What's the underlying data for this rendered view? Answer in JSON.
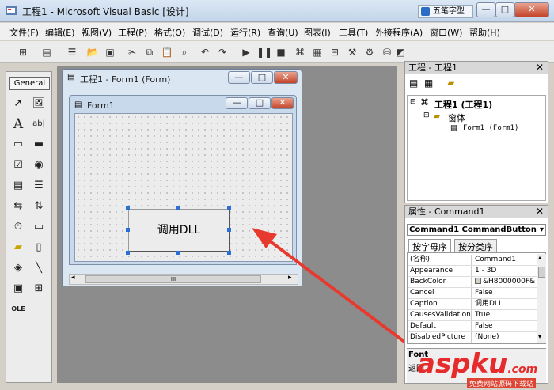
{
  "window": {
    "title": "工程1 - Microsoft Visual Basic [设计]",
    "ime_label": "五笔字型",
    "minimize": "—",
    "maximize": "□",
    "close": "✕"
  },
  "menu": [
    "文件(F)",
    "编辑(E)",
    "视图(V)",
    "工程(P)",
    "格式(O)",
    "调试(D)",
    "运行(R)",
    "查询(U)",
    "图表(I)",
    "工具(T)",
    "外接程序(A)",
    "窗口(W)",
    "帮助(H)"
  ],
  "toolbox": {
    "tab": "General",
    "tools": [
      "pointer-icon",
      "picturebox-icon",
      "label-icon",
      "textbox-icon",
      "frame-icon",
      "commandbutton-icon",
      "checkbox-icon",
      "optionbutton-icon",
      "combobox-icon",
      "listbox-icon",
      "hscrollbar-icon",
      "vscrollbar-icon",
      "timer-icon",
      "drivelistbox-icon",
      "dirlistbox-icon",
      "filelistbox-icon",
      "shape-icon",
      "line-icon",
      "image-icon",
      "data-icon",
      "ole-icon"
    ]
  },
  "project_form_window": {
    "title": "工程1 - Form1 (Form)"
  },
  "form": {
    "title": "Form1",
    "button_caption": "调用DLL",
    "scroll_grip": "III"
  },
  "project_explorer": {
    "title": "工程 - 工程1",
    "root": "工程1 (工程1)",
    "folder": "窗体",
    "item": "Form1 (Form1)"
  },
  "properties": {
    "title": "属性 - Command1",
    "object": "Command1 CommandButton",
    "tab_alpha": "按字母序",
    "tab_category": "按分类序",
    "rows": [
      {
        "name": "(名称)",
        "value": "Command1"
      },
      {
        "name": "Appearance",
        "value": "1 - 3D"
      },
      {
        "name": "BackColor",
        "value": "&H8000000F&"
      },
      {
        "name": "Cancel",
        "value": "False"
      },
      {
        "name": "Caption",
        "value": "调用DLL"
      },
      {
        "name": "CausesValidation",
        "value": "True"
      },
      {
        "name": "Default",
        "value": "False"
      },
      {
        "name": "DisabledPicture",
        "value": "(None)"
      }
    ],
    "desc_title": "Font",
    "desc_text": "返回"
  },
  "watermark": {
    "brand": "aspku",
    "suffix": ".com",
    "subtitle": "免费网站源码下载站"
  },
  "colors": {
    "accent_arrow": "#e8392e",
    "selection_handle": "#2a6fd6"
  }
}
